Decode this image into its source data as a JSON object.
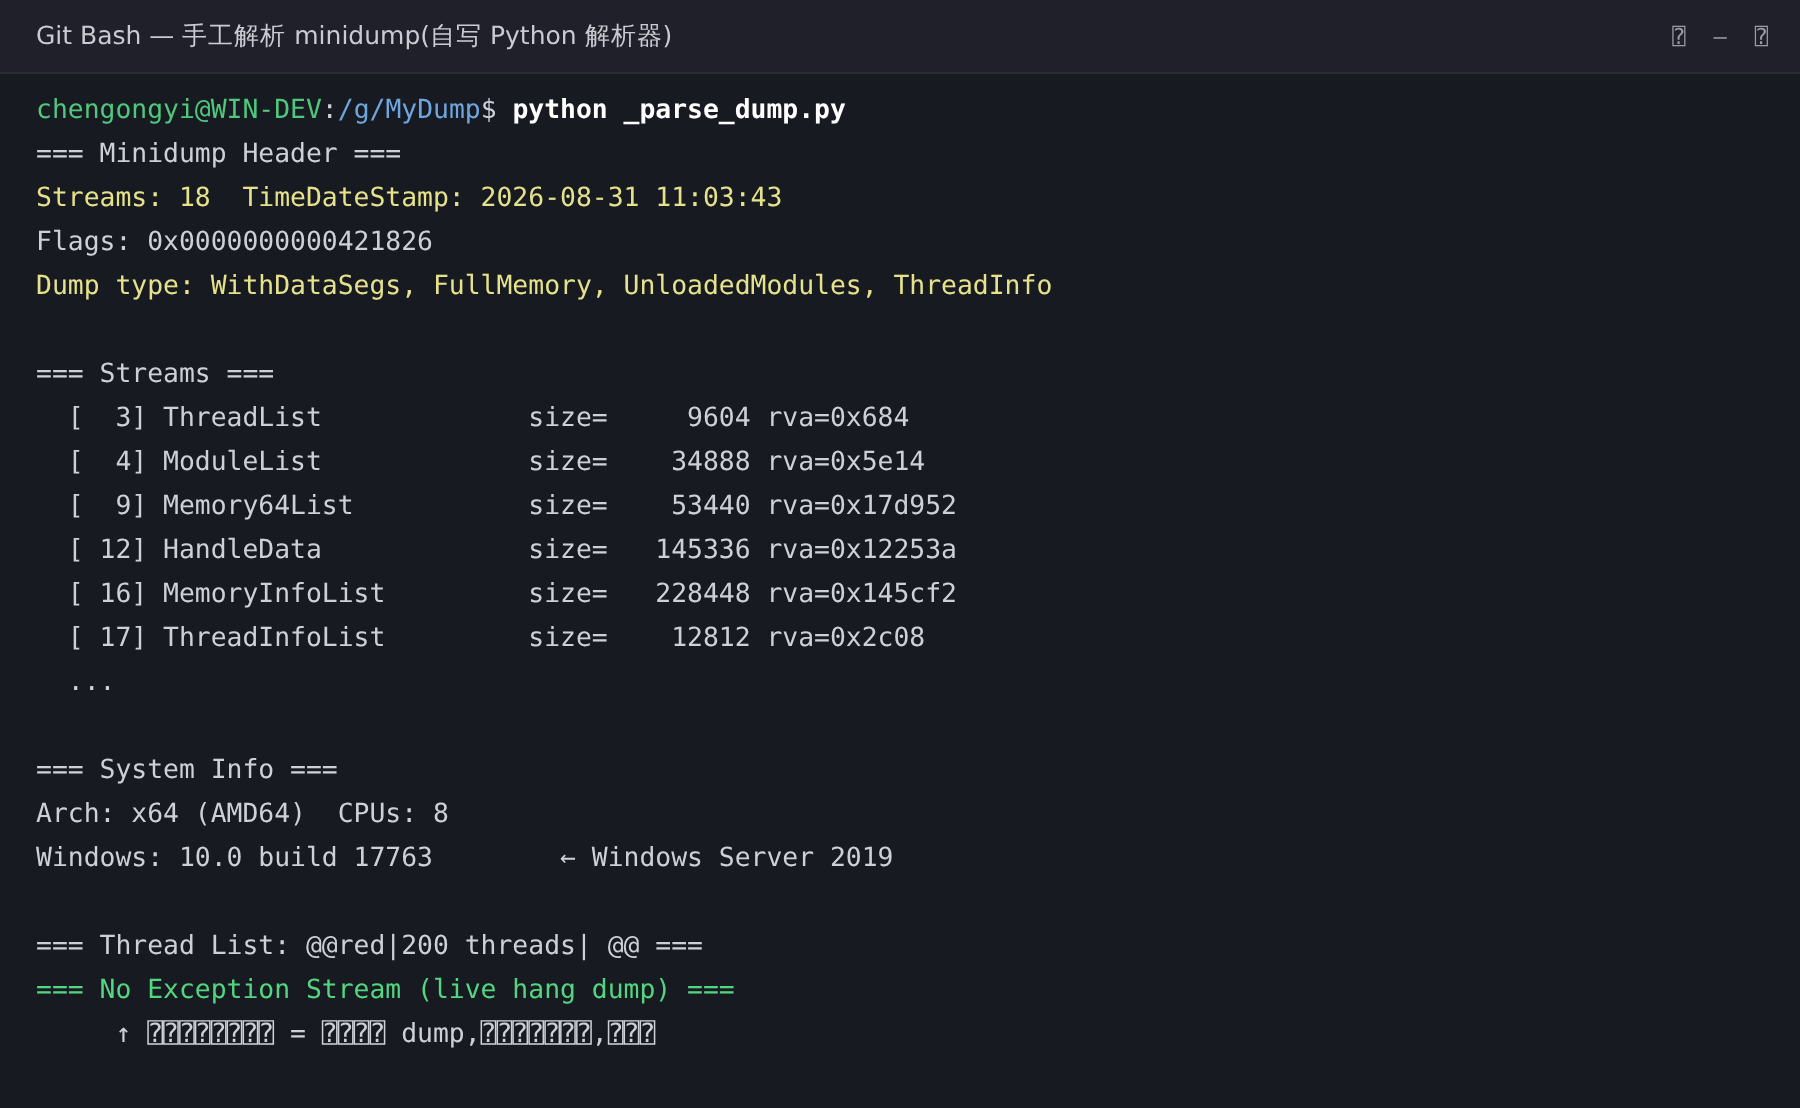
{
  "window": {
    "title": "Git Bash — 手工解析 minidump(自写 Python 解析器)",
    "controls": [
      "⍰",
      "—",
      "⍰"
    ]
  },
  "prompt": {
    "user": "chengongyi@WIN-DEV",
    "separator": ":",
    "path": "/g/MyDump",
    "symbol": "$",
    "command": "python _parse_dump.py"
  },
  "lines": [
    {
      "kind": "plain",
      "text": "=== Minidump Header ==="
    },
    {
      "kind": "highlight",
      "text": "Streams: 18  TimeDateStamp: 2026-08-31 11:03:43"
    },
    {
      "kind": "plain",
      "text": "Flags: 0x0000000000421826"
    },
    {
      "kind": "highlight",
      "text": "Dump type: WithDataSegs, FullMemory, UnloadedModules, ThreadInfo"
    },
    {
      "kind": "blank"
    },
    {
      "kind": "plain",
      "text": "=== Streams ==="
    },
    {
      "kind": "plain",
      "text": "  [  3] ThreadList             size=     9604 rva=0x684"
    },
    {
      "kind": "plain",
      "text": "  [  4] ModuleList             size=    34888 rva=0x5e14"
    },
    {
      "kind": "plain",
      "text": "  [  9] Memory64List           size=    53440 rva=0x17d952"
    },
    {
      "kind": "plain",
      "text": "  [ 12] HandleData             size=   145336 rva=0x12253a"
    },
    {
      "kind": "plain",
      "text": "  [ 16] MemoryInfoList         size=   228448 rva=0x145cf2"
    },
    {
      "kind": "plain",
      "text": "  [ 17] ThreadInfoList         size=    12812 rva=0x2c08"
    },
    {
      "kind": "plain",
      "text": "  ..."
    },
    {
      "kind": "blank"
    },
    {
      "kind": "plain",
      "text": "=== System Info ==="
    },
    {
      "kind": "plain",
      "text": "Arch: x64 (AMD64)  CPUs: 8"
    },
    {
      "kind": "plain",
      "text": "Windows: 10.0 build 17763        ← Windows Server 2019"
    },
    {
      "kind": "blank"
    },
    {
      "kind": "plain",
      "text": "=== Thread List: @@red|200 threads| @@ ==="
    },
    {
      "kind": "success",
      "text": "=== No Exception Stream (live hang dump) ==="
    },
    {
      "kind": "plain",
      "text": "     ↑ ⍰⍰⍰⍰⍰⍰⍰⍰ = ⍰⍰⍰⍰ dump,⍰⍰⍰⍰⍰⍰⍰,⍰⍰⍰"
    }
  ]
}
